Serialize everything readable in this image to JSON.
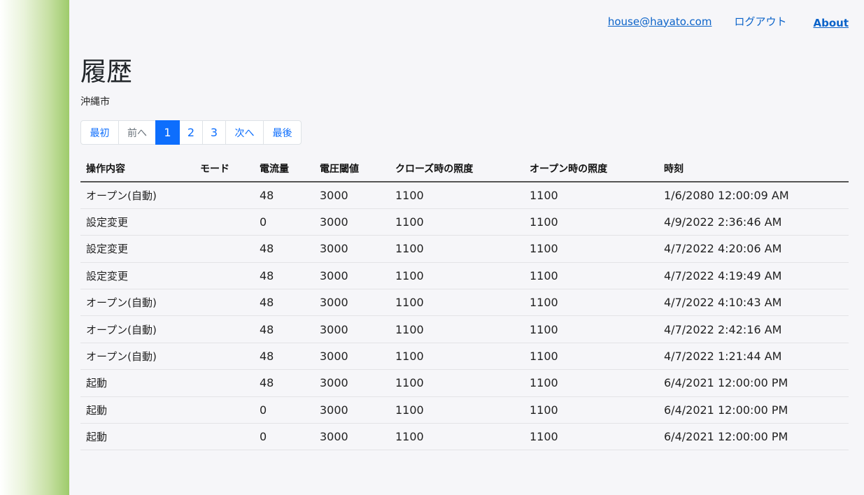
{
  "header": {
    "email": "house@hayato.com",
    "logout": "ログアウト",
    "about": "About"
  },
  "page": {
    "title": "履歴",
    "city": "沖縄市"
  },
  "pagination": [
    {
      "label": "最初",
      "state": "link"
    },
    {
      "label": "前へ",
      "state": "disabled"
    },
    {
      "label": "1",
      "state": "active"
    },
    {
      "label": "2",
      "state": "link"
    },
    {
      "label": "3",
      "state": "link"
    },
    {
      "label": "次へ",
      "state": "link"
    },
    {
      "label": "最後",
      "state": "link"
    }
  ],
  "table": {
    "headers": [
      "操作内容",
      "モード",
      "電流量",
      "電圧閾値",
      "クローズ時の照度",
      "オープン時の照度",
      "時刻"
    ],
    "rows": [
      [
        "オープン(自動)",
        "",
        "48",
        "3000",
        "1100",
        "1100",
        "1/6/2080 12:00:09 AM"
      ],
      [
        "設定変更",
        "",
        "0",
        "3000",
        "1100",
        "1100",
        "4/9/2022 2:36:46 AM"
      ],
      [
        "設定変更",
        "",
        "48",
        "3000",
        "1100",
        "1100",
        "4/7/2022 4:20:06 AM"
      ],
      [
        "設定変更",
        "",
        "48",
        "3000",
        "1100",
        "1100",
        "4/7/2022 4:19:49 AM"
      ],
      [
        "オープン(自動)",
        "",
        "48",
        "3000",
        "1100",
        "1100",
        "4/7/2022 4:10:43 AM"
      ],
      [
        "オープン(自動)",
        "",
        "48",
        "3000",
        "1100",
        "1100",
        "4/7/2022 2:42:16 AM"
      ],
      [
        "オープン(自動)",
        "",
        "48",
        "3000",
        "1100",
        "1100",
        "4/7/2022 1:21:44 AM"
      ],
      [
        "起動",
        "",
        "48",
        "3000",
        "1100",
        "1100",
        "6/4/2021 12:00:00 PM"
      ],
      [
        "起動",
        "",
        "0",
        "3000",
        "1100",
        "1100",
        "6/4/2021 12:00:00 PM"
      ],
      [
        "起動",
        "",
        "0",
        "3000",
        "1100",
        "1100",
        "6/4/2021 12:00:00 PM"
      ]
    ]
  }
}
